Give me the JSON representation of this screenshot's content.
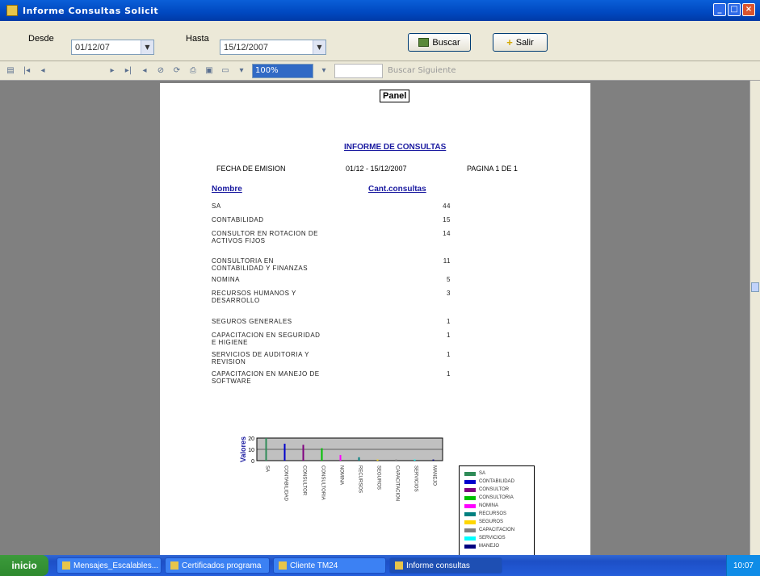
{
  "window": {
    "title": "Informe Consultas Solicit"
  },
  "filter": {
    "from_label": "Desde",
    "from_value": "01/12/07",
    "to_label": "Hasta",
    "to_value": "15/12/2007",
    "search_label": "Buscar",
    "exit_label": "Salir"
  },
  "toolbar": {
    "zoom": "100%",
    "find_label": "Buscar  Siguiente"
  },
  "report": {
    "chip": "Panel",
    "title": "INFORME DE CONSULTAS",
    "header_left": "FECHA DE EMISION",
    "header_mid": "01/12 - 15/12/2007",
    "header_right": "PAGINA 1 DE 1",
    "col_name": "Nombre",
    "col_count": "Cant.consultas",
    "rows": [
      {
        "name": "SA",
        "value": "44"
      },
      {
        "name": "CONTABILIDAD",
        "value": "15"
      },
      {
        "name": "CONSULTOR EN ROTACION DE ACTIVOS FIJOS",
        "value": "14"
      },
      {
        "name": "CONSULTORIA EN CONTABILIDAD Y FINANZAS",
        "value": "11"
      },
      {
        "name": "NOMINA",
        "value": "5"
      },
      {
        "name": "RECURSOS HUMANOS Y DESARROLLO",
        "value": "3"
      },
      {
        "name": "SEGUROS GENERALES",
        "value": "1"
      },
      {
        "name": "CAPACITACION EN SEGURIDAD E HIGIENE",
        "value": "1"
      },
      {
        "name": "SERVICIOS DE AUDITORIA Y REVISION",
        "value": "1"
      },
      {
        "name": "CAPACITACION EN MANEJO DE SOFTWARE",
        "value": "1"
      }
    ]
  },
  "chart_data": {
    "type": "bar",
    "ylabel": "Valores",
    "ylim": [
      0,
      20
    ],
    "yticks": [
      "20",
      "10",
      "0"
    ],
    "categories": [
      "SA",
      "CONTABILIDAD",
      "CONSULTOR",
      "CONSULTORIA",
      "NOMINA",
      "RECURSOS",
      "SEGUROS",
      "CAPACITACION",
      "SERVICIOS",
      "MANEJO"
    ],
    "values": [
      44,
      15,
      14,
      11,
      5,
      3,
      1,
      1,
      1,
      1
    ],
    "colors": [
      "#2e8b57",
      "#0000cd",
      "#800080",
      "#00c000",
      "#ff00ff",
      "#008080",
      "#ffd700",
      "#808080",
      "#00ffff",
      "#000080"
    ],
    "legend": [
      "SA",
      "CONTABILIDAD",
      "CONSULTOR",
      "CONSULTORIA",
      "NOMINA",
      "RECURSOS",
      "SEGUROS",
      "CAPACITACION",
      "SERVICIOS",
      "MANEJO"
    ]
  },
  "taskbar": {
    "start": "inicio",
    "tasks": [
      "Mensajes_Escalables...",
      "Certificados programa",
      "Cliente TM24",
      "Informe consultas"
    ],
    "clock": "10:07"
  }
}
